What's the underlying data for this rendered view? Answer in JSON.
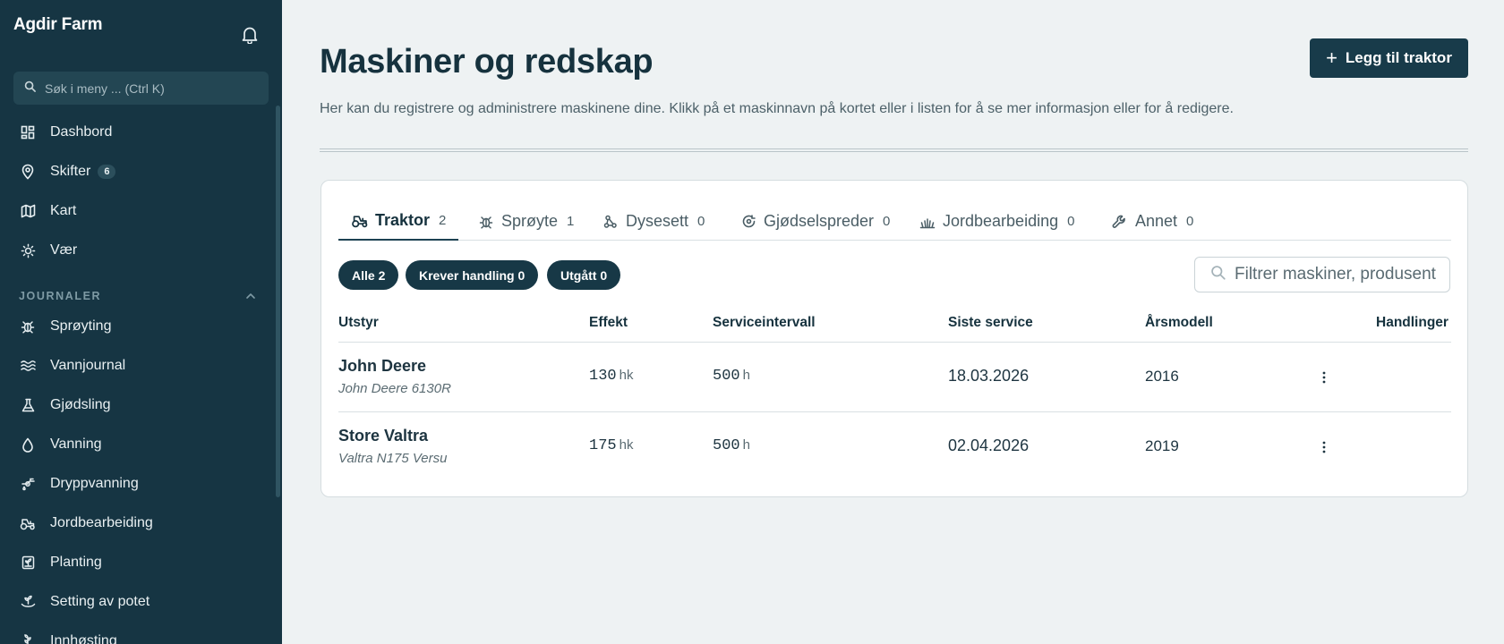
{
  "app": {
    "brand": "Agdir Farm"
  },
  "sidebar": {
    "search_placeholder": "Søk i meny ... (Ctrl K)",
    "items": [
      {
        "label": "Dashbord",
        "icon": "dashboard-icon"
      },
      {
        "label": "Skifter",
        "icon": "map-pin-icon",
        "badge": "6"
      },
      {
        "label": "Kart",
        "icon": "map-icon"
      },
      {
        "label": "Vær",
        "icon": "sun-icon"
      }
    ],
    "section_label": "JOURNALER",
    "journal_items": [
      {
        "label": "Sprøyting",
        "icon": "bug-icon"
      },
      {
        "label": "Vannjournal",
        "icon": "waves-icon"
      },
      {
        "label": "Gjødsling",
        "icon": "flask-icon"
      },
      {
        "label": "Vanning",
        "icon": "droplet-icon"
      },
      {
        "label": "Dryppvanning",
        "icon": "drip-irrigation-icon"
      },
      {
        "label": "Jordbearbeiding",
        "icon": "tractor-icon"
      },
      {
        "label": "Planting",
        "icon": "planting-icon"
      },
      {
        "label": "Setting av potet",
        "icon": "sprout-icon"
      },
      {
        "label": "Innhøsting",
        "icon": "harvest-icon"
      }
    ]
  },
  "header": {
    "title": "Maskiner og redskap",
    "description": "Her kan du registrere og administrere maskinene dine. Klikk på et maskinnavn på kortet eller i listen for å se mer informasjon eller for å redigere.",
    "add_button": "Legg til traktor"
  },
  "tabs": [
    {
      "label": "Traktor",
      "count": "2",
      "icon": "tractor-icon",
      "active": true
    },
    {
      "label": "Sprøyte",
      "count": "1",
      "icon": "bug-icon"
    },
    {
      "label": "Dysesett",
      "count": "0",
      "icon": "nozzle-icon"
    },
    {
      "label": "Gjødselspreder",
      "count": "0",
      "icon": "spreader-icon"
    },
    {
      "label": "Jordbearbeiding",
      "count": "0",
      "icon": "soil-icon"
    },
    {
      "label": "Annet",
      "count": "0",
      "icon": "wrench-icon"
    }
  ],
  "filters": {
    "chips": [
      "Alle 2",
      "Krever handling 0",
      "Utgått 0"
    ],
    "search_placeholder": "Filtrer maskiner, produsent"
  },
  "table": {
    "columns": [
      "Utstyr",
      "Effekt",
      "Serviceintervall",
      "Siste service",
      "Årsmodell",
      "Handlinger"
    ],
    "rows": [
      {
        "name": "John Deere",
        "model": "John Deere 6130R",
        "power": "130",
        "power_unit": "hk",
        "interval": "500",
        "interval_unit": "h",
        "last_service": "18.03.2026",
        "year": "2016"
      },
      {
        "name": "Store Valtra",
        "model": "Valtra N175 Versu",
        "power": "175",
        "power_unit": "hk",
        "interval": "500",
        "interval_unit": "h",
        "last_service": "02.04.2026",
        "year": "2019"
      }
    ]
  },
  "colors": {
    "sidebar": "#163543",
    "accent": "#183b4a",
    "background": "#eef2f3"
  }
}
